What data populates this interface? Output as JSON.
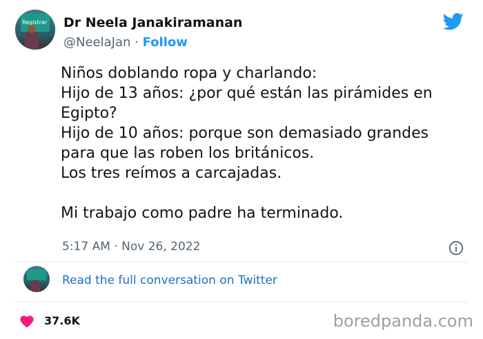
{
  "header": {
    "name": "Dr Neela Janakiramanan",
    "handle": "@NeelaJan",
    "separator": "·",
    "follow_label": "Follow",
    "avatar_sign_text": "Registrar"
  },
  "tweet": {
    "lines": [
      "Niños doblando ropa y charlando:",
      "Hijo de 13 años: ¿por qué están las pirámides en",
      "Egipto?",
      "Hijo de 10 años: porque son demasiado grandes",
      "para que las roben los británicos.",
      "Los tres reímos a carcajadas."
    ],
    "closing": "Mi trabajo como padre ha terminado.",
    "time": "5:17 AM",
    "date": "Nov 26, 2022",
    "meta_separator": "·"
  },
  "conversation": {
    "link_label": "Read the full conversation on Twitter"
  },
  "footer": {
    "likes": "37.6K",
    "watermark": "boredpanda.com"
  },
  "colors": {
    "twitter_blue": "#1d9bf0",
    "heart": "#f91880",
    "muted": "#536471",
    "link": "#1d6fc4"
  },
  "icons": [
    "twitter-bird-icon",
    "info-icon",
    "heart-icon"
  ]
}
